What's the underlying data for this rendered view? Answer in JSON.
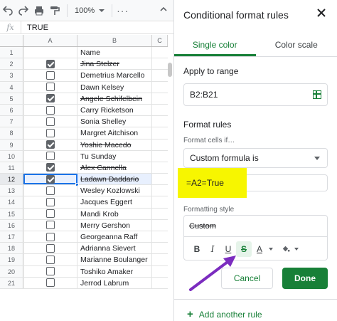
{
  "toolbar": {
    "zoom": "100%",
    "more": "···"
  },
  "formula_bar": {
    "fx": "fx",
    "value": "TRUE"
  },
  "columns": [
    "A",
    "B",
    "C"
  ],
  "rows": [
    {
      "num": "1",
      "checked": null,
      "name": "Name",
      "strike": false
    },
    {
      "num": "2",
      "checked": true,
      "name": "Jina Stelzer",
      "strike": true
    },
    {
      "num": "3",
      "checked": false,
      "name": "Demetrius Marcello",
      "strike": false
    },
    {
      "num": "4",
      "checked": false,
      "name": "Dawn Kelsey",
      "strike": false
    },
    {
      "num": "5",
      "checked": true,
      "name": "Angele Schifelbein",
      "strike": true
    },
    {
      "num": "6",
      "checked": false,
      "name": "Carry Ricketson",
      "strike": false
    },
    {
      "num": "7",
      "checked": false,
      "name": "Sonia Shelley",
      "strike": false
    },
    {
      "num": "8",
      "checked": false,
      "name": "Margret Aitchison",
      "strike": false
    },
    {
      "num": "9",
      "checked": true,
      "name": "Yoshie Macedo",
      "strike": true
    },
    {
      "num": "10",
      "checked": false,
      "name": "Tu Sunday",
      "strike": false
    },
    {
      "num": "11",
      "checked": true,
      "name": "Alex Cannella",
      "strike": true
    },
    {
      "num": "12",
      "checked": true,
      "name": "Ladawn Daddario",
      "strike": true
    },
    {
      "num": "13",
      "checked": false,
      "name": "Wesley Kozlowski",
      "strike": false
    },
    {
      "num": "14",
      "checked": false,
      "name": "Jacques Eggert",
      "strike": false
    },
    {
      "num": "15",
      "checked": false,
      "name": "Mandi Krob",
      "strike": false
    },
    {
      "num": "16",
      "checked": false,
      "name": "Merry Gershon",
      "strike": false
    },
    {
      "num": "17",
      "checked": false,
      "name": "Georgeanna Raff",
      "strike": false
    },
    {
      "num": "18",
      "checked": false,
      "name": "Adrianna Sievert",
      "strike": false
    },
    {
      "num": "19",
      "checked": false,
      "name": "Marianne Boulanger",
      "strike": false
    },
    {
      "num": "20",
      "checked": false,
      "name": "Toshiko Amaker",
      "strike": false
    },
    {
      "num": "21",
      "checked": false,
      "name": "Jerrod Labrum",
      "strike": false
    }
  ],
  "selected_row": "12",
  "panel": {
    "title": "Conditional format rules",
    "tabs": [
      "Single color",
      "Color scale"
    ],
    "active_tab": "Single color",
    "apply_to_range_label": "Apply to range",
    "range_value": "B2:B21",
    "format_rules_label": "Format rules",
    "format_cells_if_label": "Format cells if…",
    "condition": "Custom formula is",
    "formula_value": "=A2=True",
    "formatting_style_label": "Formatting style",
    "preview_text": "Custom",
    "format_buttons": {
      "bold": "B",
      "italic": "I",
      "underline": "U",
      "strikethrough": "S",
      "text_color": "A"
    },
    "cancel_label": "Cancel",
    "done_label": "Done",
    "add_rule_label": "Add another rule",
    "add_rule_icon": "+"
  },
  "colors": {
    "accent_green": "#188038",
    "highlight_yellow": "#f7f600",
    "arrow_purple": "#7b2cbf",
    "selection_blue": "#1a73e8"
  }
}
